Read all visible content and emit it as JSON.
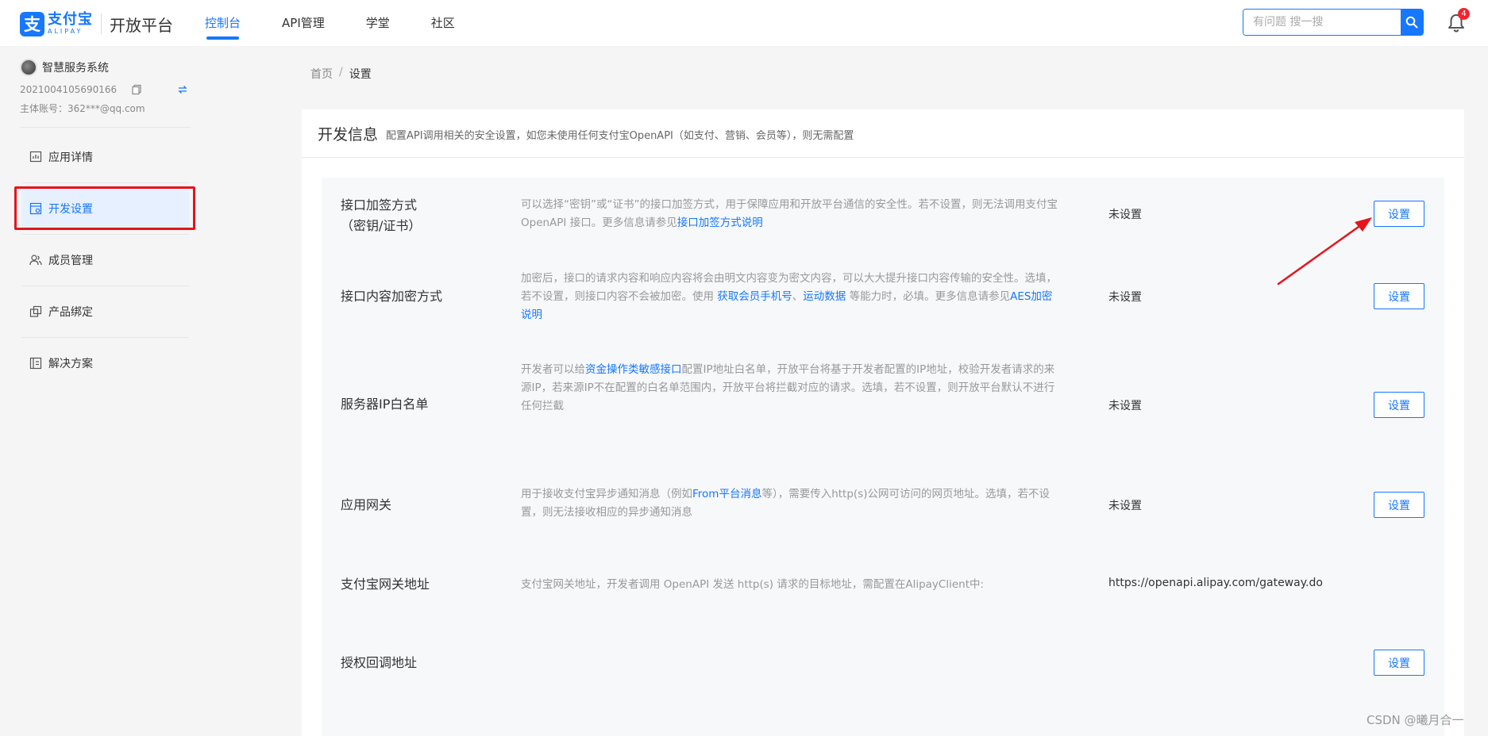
{
  "header": {
    "logo_cn": "支付宝",
    "logo_en": "ALIPAY",
    "platform": "开放平台",
    "nav": [
      {
        "label": "控制台",
        "active": true
      },
      {
        "label": "API管理",
        "active": false
      },
      {
        "label": "学堂",
        "active": false
      },
      {
        "label": "社区",
        "active": false
      }
    ],
    "search_placeholder": "有问题 搜一搜",
    "notification_count": "4"
  },
  "sidebar": {
    "app_name": "智慧服务系统",
    "app_id": "2021004105690166",
    "owner": "主体账号：362***@qq.com",
    "menu": [
      {
        "label": "应用详情",
        "icon": "chart-icon"
      },
      {
        "label": "开发设置",
        "icon": "dev-settings-icon",
        "active": true
      },
      {
        "label": "成员管理",
        "icon": "members-icon"
      },
      {
        "label": "产品绑定",
        "icon": "product-bind-icon"
      },
      {
        "label": "解决方案",
        "icon": "solution-icon"
      }
    ]
  },
  "breadcrumb": {
    "home": "首页",
    "separator": "/",
    "current": "设置"
  },
  "panel": {
    "title": "开发信息",
    "description": "配置API调用相关的安全设置，如您未使用任何支付宝OpenAPI（如支付、营销、会员等），则无需配置"
  },
  "rows": [
    {
      "label_line1": "接口加签方式",
      "label_line2": "（密钥/证书）",
      "desc_text": "可以选择“密钥”或“证书”的接口加签方式，用于保障应用和开放平台通信的安全性。若不设置，则无法调用支付宝 OpenAPI 接口。更多信息请参见",
      "desc_link": "接口加签方式说明",
      "status": "未设置",
      "button": "设置"
    },
    {
      "label": "接口内容加密方式",
      "desc_part1": "加密后，接口的请求内容和响应内容将会由明文内容变为密文内容，可以大大提升接口内容传输的安全性。选填，若不设置，则接口内容不会被加密。使用 ",
      "desc_link1": "获取会员手机号",
      "desc_sep": "、",
      "desc_link2": "运动数据",
      "desc_part2": " 等能力时，必填。更多信息请参见",
      "desc_link3": "AES加密说明",
      "status": "未设置",
      "button": "设置"
    },
    {
      "label": "服务器IP白名单",
      "desc_part1": "开发者可以给",
      "desc_link": "资金操作类敏感接口",
      "desc_part2": "配置IP地址白名单，开放平台将基于开发者配置的IP地址，校验开发者请求的来源IP，若来源IP不在配置的白名单范围内，开放平台将拦截对应的请求。选填，若不设置，则开放平台默认不进行任何拦截",
      "status": "未设置",
      "button": "设置"
    },
    {
      "label": "应用网关",
      "desc_part1": "用于接收支付宝异步通知消息（例如",
      "desc_link": "From平台消息",
      "desc_part2": "等），需要传入http(s)公网可访问的网页地址。选填，若不设置，则无法接收相应的异步通知消息",
      "status": "未设置",
      "button": "设置"
    },
    {
      "label": "支付宝网关地址",
      "desc": "支付宝网关地址，开发者调用 OpenAPI 发送 http(s) 请求的目标地址，需配置在AlipayClient中:",
      "value": "https://openapi.alipay.com/gateway.do"
    },
    {
      "label": "授权回调地址",
      "button": "设置"
    }
  ],
  "annotation_color": "#e6131c",
  "accent_color": "#1677ff",
  "watermark": "CSDN @曦月合一"
}
